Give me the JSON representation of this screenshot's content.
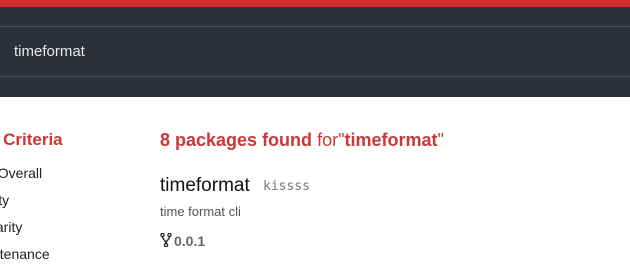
{
  "colors": {
    "brand_red": "#cb2f33",
    "header_bg": "#2c3038",
    "heading_red": "#cb3837"
  },
  "search": {
    "value": "timeformat",
    "icon": "search-icon"
  },
  "sidebar": {
    "title": "n Criteria",
    "items": [
      {
        "label": "t Overall"
      },
      {
        "label": "lity"
      },
      {
        "label": "ularity"
      },
      {
        "label": "ntenance"
      }
    ]
  },
  "results": {
    "count_text": "8 packages found",
    "for_text": "for",
    "open_quote": "\"",
    "term": "timeformat",
    "close_quote": "\""
  },
  "package": {
    "name": "timeformat",
    "publisher": "kissss",
    "description": "time format cli",
    "version": "0.0.1",
    "version_icon": "git-branch-icon"
  }
}
